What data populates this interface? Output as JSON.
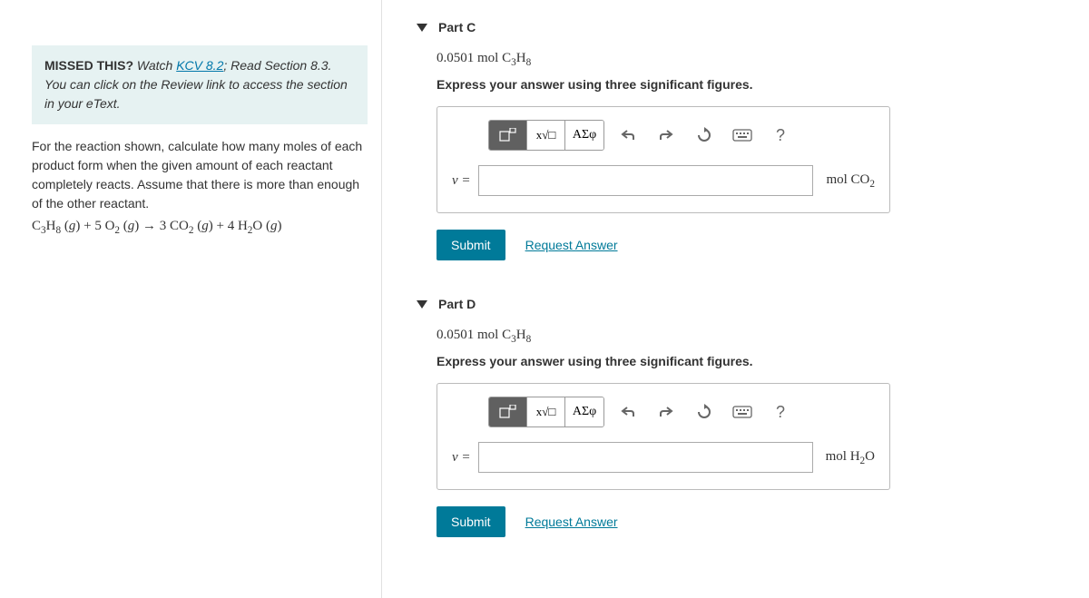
{
  "left": {
    "missed_label": "MISSED THIS?",
    "missed_text1": " Watch ",
    "missed_link": "KCV 8.2",
    "missed_text2": "; Read Section 8.3.",
    "hint": "You can click on the Review link to access the section in your eText.",
    "question": "For the reaction shown, calculate how many moles of each product form when the given amount of each reactant completely reacts. Assume that there is more than enough of the other reactant.",
    "equation_plain": "C3H8 (g) + 5 O2 (g) → 3 CO2 (g) + 4 H2O (g)"
  },
  "parts": {
    "c": {
      "title": "Part C",
      "given_val": "0.0501",
      "given_unit": "mol",
      "given_species_plain": "C3H8",
      "instruction": "Express your answer using three significant figures.",
      "var": "ν =",
      "unit_plain": "mol CO2",
      "submit": "Submit",
      "request": "Request Answer"
    },
    "d": {
      "title": "Part D",
      "given_val": "0.0501",
      "given_unit": "mol",
      "given_species_plain": "C3H8",
      "instruction": "Express your answer using three significant figures.",
      "var": "ν =",
      "unit_plain": "mol H2O",
      "submit": "Submit",
      "request": "Request Answer"
    }
  },
  "toolbar": {
    "greek": "ΑΣφ",
    "help": "?"
  }
}
